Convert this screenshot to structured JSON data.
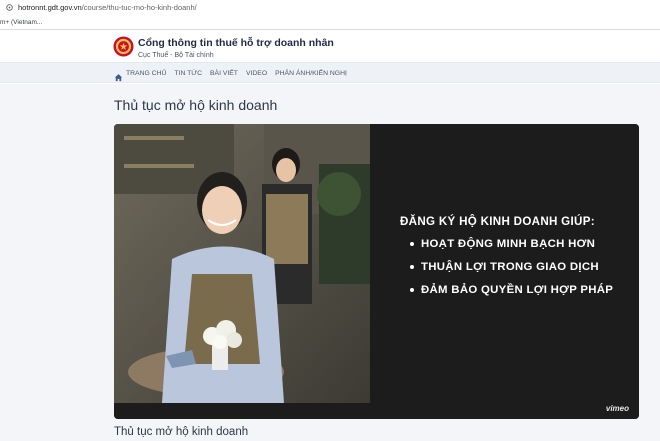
{
  "browser": {
    "url_host": "hotronnt.gdt.gov.vn",
    "url_path": "/course/thu-tuc-mo-ho-kinh-doanh/",
    "bookmark": "m+ (Vietnam..."
  },
  "header": {
    "title": "Cổng thông tin thuế hỗ trợ doanh nhân",
    "subtitle": "Cục Thuế - Bộ Tài chính"
  },
  "nav": {
    "items": [
      "TRANG CHỦ",
      "TIN TỨC",
      "BÀI VIẾT",
      "VIDEO",
      "PHẢN ÁNH/KIẾN NGHỊ"
    ]
  },
  "main": {
    "page_title": "Thủ tục mở hộ kinh doanh",
    "section_title": "Thủ tục mở hộ kinh doanh"
  },
  "video": {
    "heading": "ĐĂNG KÝ HỘ KINH DOANH GIÚP:",
    "bullets": [
      "HOẠT ĐỘNG MINH BẠCH HƠN",
      "THUẬN LỢI TRONG GIAO DỊCH",
      "ĐẢM BẢO QUYỀN LỢI HỢP PHÁP"
    ],
    "player_brand": "vimeo"
  },
  "colors": {
    "accent_red": "#c8102e",
    "emblem_gold": "#f2c14e",
    "nav_bg": "#eef2f7",
    "video_bg": "#1c1c1c"
  },
  "icons": {
    "address_bar": "site-info-icon",
    "nav_home": "home-icon",
    "logo": "tax-emblem-icon"
  }
}
